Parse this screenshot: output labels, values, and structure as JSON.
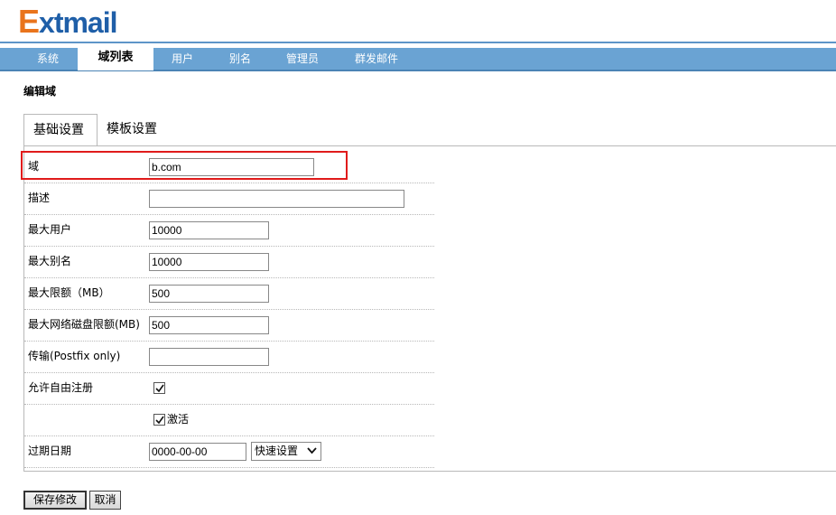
{
  "app": {
    "logo_first": "E",
    "logo_rest": "xtmail"
  },
  "nav": {
    "items": [
      {
        "label": "系统"
      },
      {
        "label": "域列表"
      },
      {
        "label": "用户"
      },
      {
        "label": "别名"
      },
      {
        "label": "管理员"
      },
      {
        "label": "群发邮件"
      }
    ],
    "active_index": 1
  },
  "page": {
    "title": "编辑域"
  },
  "tabs": [
    {
      "label": "基础设置",
      "active": true
    },
    {
      "label": "模板设置",
      "active": false
    }
  ],
  "form": {
    "domain": {
      "label": "域",
      "value": "b.com"
    },
    "description": {
      "label": "描述",
      "value": ""
    },
    "max_users": {
      "label": "最大用户",
      "value": "10000"
    },
    "max_aliases": {
      "label": "最大别名",
      "value": "10000"
    },
    "max_quota": {
      "label": "最大限额（MB）",
      "value": "500"
    },
    "max_netdisk_quota": {
      "label": "最大网络磁盘限额(MB)",
      "value": "500"
    },
    "transport": {
      "label": "传输(Postfix only)",
      "value": ""
    },
    "allow_register": {
      "label": "允许自由注册",
      "checked": true
    },
    "activate": {
      "label": "激活",
      "checked": true
    },
    "expire_date": {
      "label": "过期日期",
      "value": "0000-00-00",
      "quick_set": "快速设置"
    }
  },
  "buttons": {
    "save": "保存修改",
    "cancel": "取消"
  },
  "colors": {
    "nav_bg": "#6aa3d3",
    "highlight": "#e01b1b",
    "logo_blue": "#1f5fa8",
    "logo_orange": "#e9741c"
  },
  "icons": {
    "check": "check-icon",
    "dropdown": "chevron-down-icon"
  }
}
